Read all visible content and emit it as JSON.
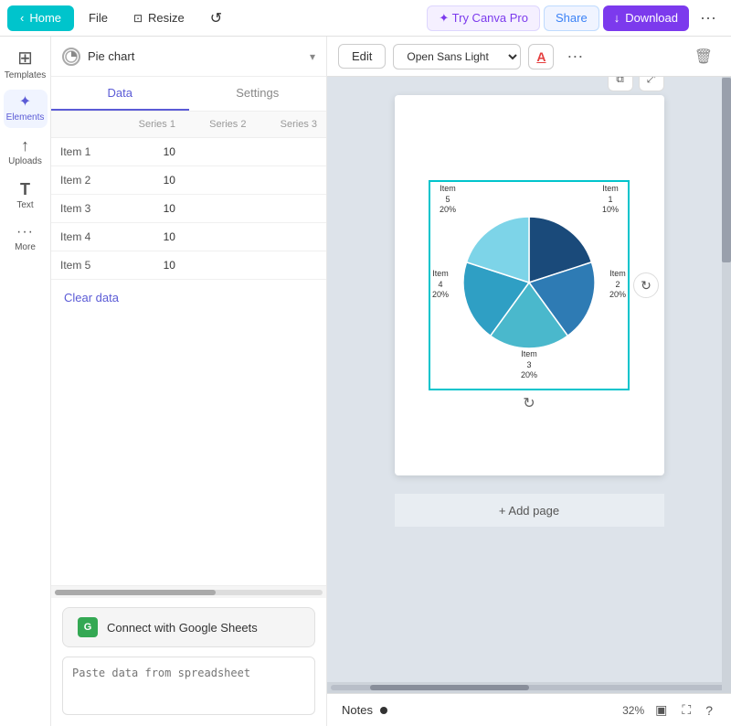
{
  "navbar": {
    "home_label": "Home",
    "file_label": "File",
    "resize_label": "Resize",
    "try_pro_label": "✦ Try Canva Pro",
    "share_label": "Share",
    "download_label": "Download",
    "more_dots": "···"
  },
  "sidebar": {
    "items": [
      {
        "id": "templates",
        "icon": "⊞",
        "label": "Templates"
      },
      {
        "id": "elements",
        "icon": "✦",
        "label": "Elements"
      },
      {
        "id": "uploads",
        "icon": "↑",
        "label": "Uploads"
      },
      {
        "id": "text",
        "icon": "T",
        "label": "Text"
      },
      {
        "id": "more",
        "icon": "···",
        "label": "More"
      }
    ]
  },
  "panel": {
    "chart_title": "Pie chart",
    "tab_data": "Data",
    "tab_settings": "Settings",
    "table": {
      "headers": [
        "",
        "Series 1",
        "Series 2",
        "Series 3"
      ],
      "rows": [
        {
          "label": "Item 1",
          "s1": "10",
          "s2": "",
          "s3": ""
        },
        {
          "label": "Item 2",
          "s1": "10",
          "s2": "",
          "s3": ""
        },
        {
          "label": "Item 3",
          "s1": "10",
          "s2": "",
          "s3": ""
        },
        {
          "label": "Item 4",
          "s1": "10",
          "s2": "",
          "s3": ""
        },
        {
          "label": "Item 5",
          "s1": "10",
          "s2": "",
          "s3": ""
        }
      ]
    },
    "clear_data": "Clear data",
    "google_sheets_label": "Connect with Google Sheets",
    "paste_placeholder": "Paste data from spreadsheet"
  },
  "toolbar": {
    "edit_label": "Edit",
    "font_label": "Open Sans Light",
    "font_color_icon": "A",
    "more_label": "···",
    "trash_icon": "🗑"
  },
  "pie_chart": {
    "items": [
      {
        "label": "Item 1",
        "pct": "10%",
        "color": "#1a4a7a",
        "start": 0,
        "slice": 72
      },
      {
        "label": "Item 2",
        "pct": "20%",
        "color": "#2e7bb4",
        "start": 72,
        "slice": 72
      },
      {
        "label": "Item 3",
        "pct": "20%",
        "color": "#4ab8cc",
        "start": 144,
        "slice": 72
      },
      {
        "label": "Item 4",
        "pct": "20%",
        "color": "#2f9fc4",
        "start": 216,
        "slice": 72
      },
      {
        "label": "Item 5",
        "pct": "20%",
        "color": "#7dd4e8",
        "start": 288,
        "slice": 72
      }
    ],
    "label_item1": "Item\n1\n10%",
    "label_item2": "Item\n2\n20%",
    "label_item3": "Item\n3\n20%",
    "label_item4": "Item\n4\n20%",
    "label_item5": "Item\n5\n20%"
  },
  "canvas": {
    "add_page_label": "+ Add page"
  },
  "bottom_bar": {
    "notes_label": "Notes",
    "zoom_pct": "32%"
  }
}
